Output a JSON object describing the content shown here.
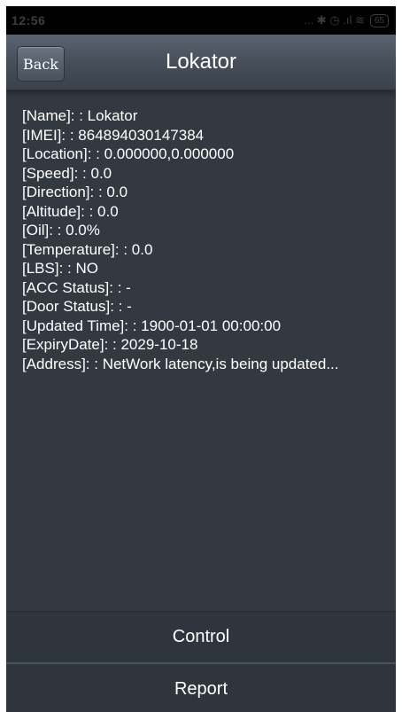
{
  "status_bar": {
    "time": "12:56",
    "icons_text": "... ✱ ◷ .ıl ≋",
    "battery": "65"
  },
  "header": {
    "back_label": "Back",
    "title": "Lokator"
  },
  "info": {
    "rows": [
      "[Name]: : Lokator",
      "[IMEI]: : 864894030147384",
      "[Location]: : 0.000000,0.000000",
      "[Speed]: : 0.0",
      "[Direction]: : 0.0",
      "[Altitude]: : 0.0",
      "[Oil]:  : 0.0%",
      "[Temperature]: : 0.0",
      "[LBS]:  : NO",
      "[ACC Status]: : -",
      "[Door Status]: : -",
      "[Updated Time]:  : 1900-01-01 00:00:00",
      "[ExpiryDate]: : 2029-10-18",
      "[Address]:  : NetWork latency,is being updated..."
    ]
  },
  "buttons": {
    "control_label": "Control",
    "report_label": "Report"
  }
}
